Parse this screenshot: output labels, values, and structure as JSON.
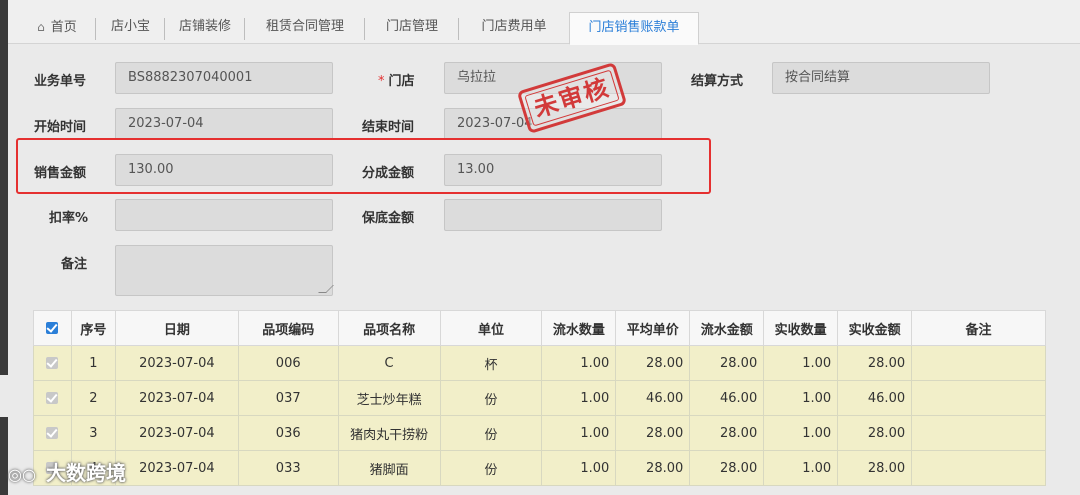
{
  "tabs": [
    {
      "label": "首页",
      "icon": "home-icon"
    },
    {
      "label": "店小宝"
    },
    {
      "label": "店铺装修"
    },
    {
      "label": "租赁合同管理"
    },
    {
      "label": "门店管理"
    },
    {
      "label": "门店费用单"
    },
    {
      "label": "门店销售账款单",
      "active": true
    }
  ],
  "form": {
    "business_no": {
      "label": "业务单号",
      "value": "BS8882307040001"
    },
    "store": {
      "required_mark": "*",
      "label": "门店",
      "value": "乌拉拉"
    },
    "settlement": {
      "label": "结算方式",
      "value": "按合同结算"
    },
    "start_time": {
      "label": "开始时间",
      "value": "2023-07-04"
    },
    "end_time": {
      "label": "结束时间",
      "value": "2023-07-04"
    },
    "sales_amount": {
      "label": "销售金额",
      "value": "130.00"
    },
    "share_amount": {
      "label": "分成金额",
      "value": "13.00"
    },
    "discount_rate": {
      "label": "扣率%",
      "value": ""
    },
    "min_amount": {
      "label": "保底金额",
      "value": ""
    },
    "remark": {
      "label": "备注",
      "value": ""
    }
  },
  "stamp": {
    "text": "未审核",
    "color": "#d23a3a"
  },
  "table": {
    "headers": [
      "序号",
      "日期",
      "品项编码",
      "品项名称",
      "单位",
      "流水数量",
      "平均单价",
      "流水金额",
      "实收数量",
      "实收金额",
      "备注"
    ],
    "rows": [
      [
        "1",
        "2023-07-04",
        "006",
        "C",
        "杯",
        "1.00",
        "28.00",
        "28.00",
        "1.00",
        "28.00",
        ""
      ],
      [
        "2",
        "2023-07-04",
        "037",
        "芝士炒年糕",
        "份",
        "1.00",
        "46.00",
        "46.00",
        "1.00",
        "46.00",
        ""
      ],
      [
        "3",
        "2023-07-04",
        "036",
        "猪肉丸干捞粉",
        "份",
        "1.00",
        "28.00",
        "28.00",
        "1.00",
        "28.00",
        ""
      ],
      [
        "4",
        "2023-07-04",
        "033",
        "猪脚面",
        "份",
        "1.00",
        "28.00",
        "28.00",
        "1.00",
        "28.00",
        ""
      ]
    ]
  },
  "watermark": {
    "text": "大数跨境"
  },
  "colors": {
    "accent": "#2b7fd8",
    "highlight": "#e53030",
    "row_bg": "#f2efc9"
  }
}
